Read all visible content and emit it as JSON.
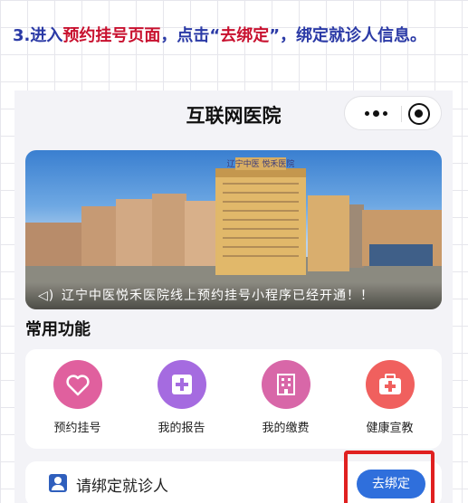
{
  "instruction": {
    "prefix": "3.进入",
    "highlight1": "预约挂号页面",
    "middle": "，点击“",
    "highlight2": "去绑定",
    "suffix": "”，绑定就诊人信息。"
  },
  "navbar": {
    "title": "互联网医院"
  },
  "banner": {
    "caption": "辽宁中医悦禾医院线上预约挂号小程序已经开通！！",
    "sign_text": "辽宁中医 悦禾医院"
  },
  "functions": {
    "title": "常用功能",
    "items": [
      {
        "label": "预约挂号",
        "icon": "heart-icon",
        "color": "#e0609e"
      },
      {
        "label": "我的报告",
        "icon": "medical-plus-icon",
        "color": "#a56be0"
      },
      {
        "label": "我的缴费",
        "icon": "building-icon",
        "color": "#d867a8"
      },
      {
        "label": "健康宣教",
        "icon": "medical-kit-icon",
        "color": "#f0605e"
      }
    ]
  },
  "bind": {
    "text": "请绑定就诊人",
    "button": "去绑定"
  },
  "colors": {
    "instruction_blue": "#2b3aa6",
    "highlight_red": "#c8102e",
    "button_blue": "#2f6fdc"
  }
}
